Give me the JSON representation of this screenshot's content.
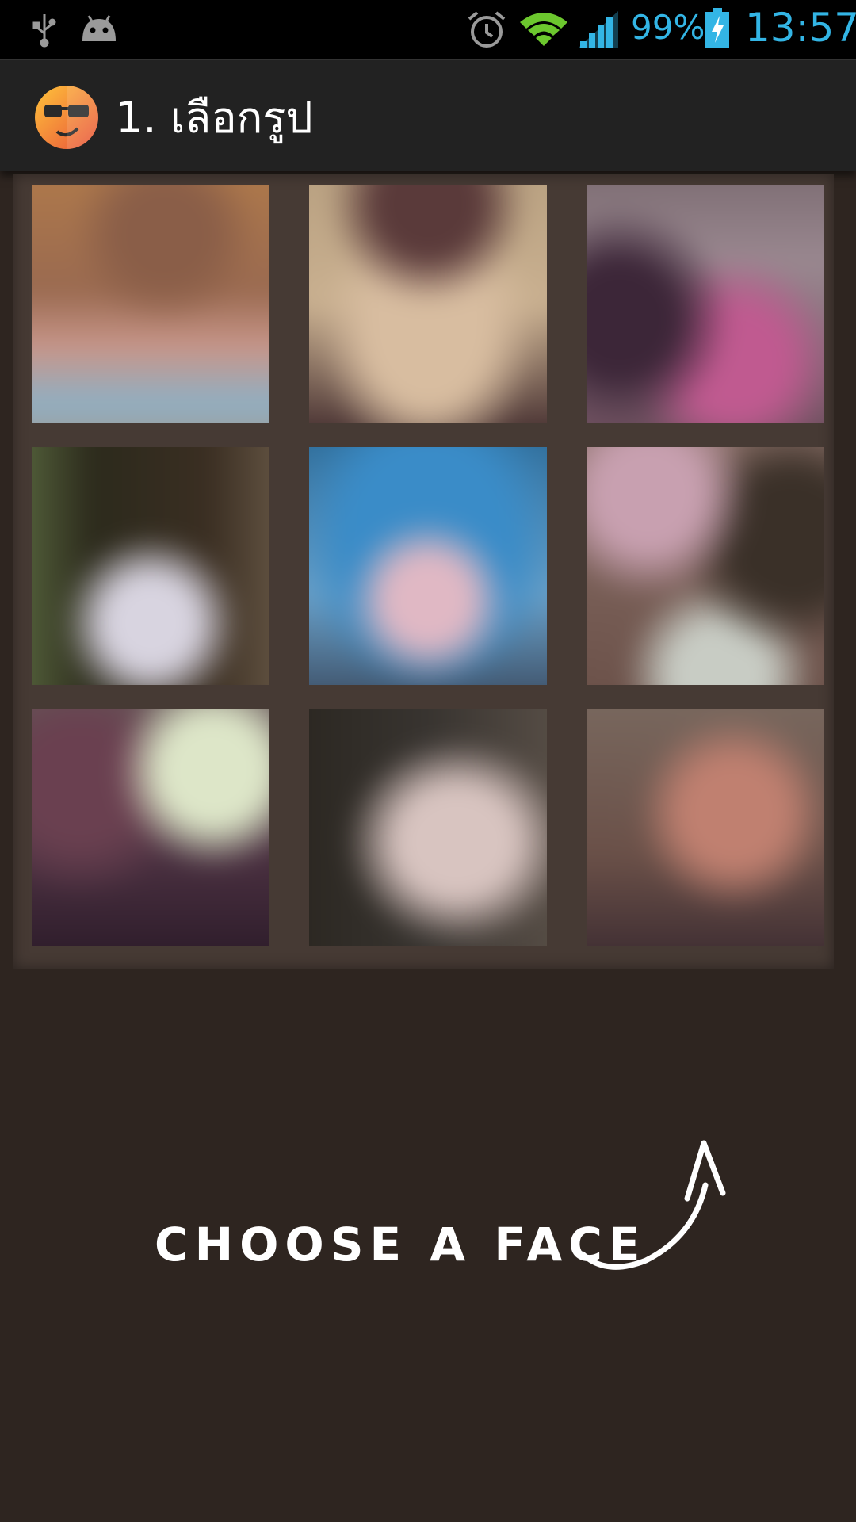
{
  "status_bar": {
    "icons_left": [
      "usb-icon",
      "android-debug-icon"
    ],
    "icons_right": [
      "alarm-icon",
      "wifi-icon",
      "signal-icon",
      "battery-charging-icon"
    ],
    "battery_percent": "99%",
    "time": "13:57",
    "accent_color": "#33b5e5"
  },
  "action_bar": {
    "app_icon": "sunglasses-face-icon",
    "title": "1. เลือกรูป"
  },
  "gallery": {
    "photo_count": 9
  },
  "hint": {
    "caption": "CHOOSE A FACE",
    "arrow_icon": "curved-arrow-icon"
  }
}
